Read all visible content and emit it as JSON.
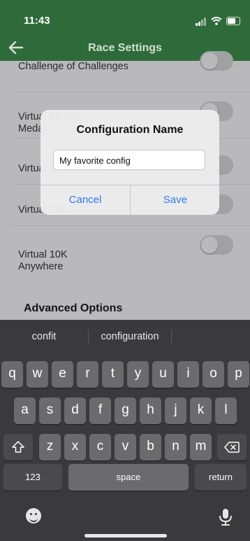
{
  "status_bar": {
    "time": "11:43"
  },
  "nav": {
    "title": "Race Settings"
  },
  "list": {
    "items": [
      {
        "label": "Challenge of Challenges",
        "enabled": false
      },
      {
        "label": "Virtual 5K with Medal",
        "enabled": false
      },
      {
        "label": "Virtual 5K no Medal",
        "enabled": false
      },
      {
        "label": "Virtual 10K",
        "enabled": false
      },
      {
        "label": "Virtual 10K Anywhere",
        "enabled": false
      }
    ],
    "section_title": "Advanced Options"
  },
  "dialog": {
    "title": "Configuration Name",
    "input_value": "My favorite config",
    "cancel_label": "Cancel",
    "save_label": "Save"
  },
  "keyboard": {
    "suggestions": [
      "confit",
      "configuration",
      ""
    ],
    "row1": [
      "q",
      "w",
      "e",
      "r",
      "t",
      "y",
      "u",
      "i",
      "o",
      "p"
    ],
    "row2": [
      "a",
      "s",
      "d",
      "f",
      "g",
      "h",
      "j",
      "k",
      "l"
    ],
    "row3": [
      "z",
      "x",
      "c",
      "v",
      "b",
      "n",
      "m"
    ],
    "numbers_label": "123",
    "space_label": "space",
    "return_label": "return"
  },
  "colors": {
    "header": "#2f6b3a",
    "accent": "#2d7af0",
    "keyboard_bg": "#3a3a3c"
  },
  "icons": {
    "back": "back-arrow-icon",
    "shift": "shift-icon",
    "delete": "delete-icon",
    "emoji": "emoji-icon",
    "mic": "microphone-icon"
  }
}
